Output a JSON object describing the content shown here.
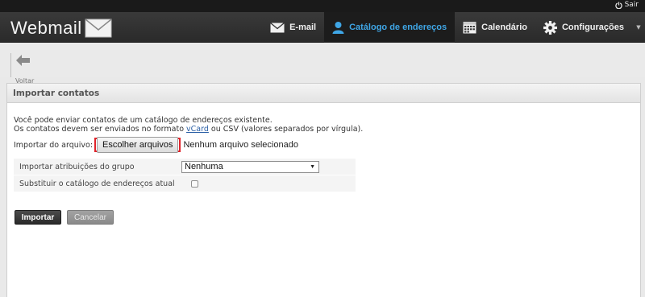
{
  "topbar": {
    "logout_label": "Sair"
  },
  "header": {
    "brand": "Webmail"
  },
  "nav": {
    "items": [
      {
        "label": "E-mail",
        "icon": "envelope-icon"
      },
      {
        "label": "Catálogo de endereços",
        "icon": "person-icon",
        "active": true
      },
      {
        "label": "Calendário",
        "icon": "calendar-icon"
      },
      {
        "label": "Configurações",
        "icon": "gear-icon"
      }
    ]
  },
  "toolbar": {
    "back_label": "Voltar"
  },
  "panel": {
    "title": "Importar contatos",
    "intro_line1": "Você pode enviar contatos de um catálogo de endereços existente.",
    "intro_line2_pre": "Os contatos devem ser enviados no formato ",
    "intro_link": "vCard",
    "intro_line2_post": " ou CSV (valores separados por vírgula).",
    "file_label": "Importar do arquivo:",
    "file_button": "Escolher arquivos",
    "file_status": "Nenhum arquivo selecionado",
    "options": [
      {
        "label": "Importar atribuições do grupo",
        "value": "Nenhuma"
      },
      {
        "label": "Substituir o catálogo de endereços atual",
        "checked": false
      }
    ],
    "import_button": "Importar",
    "cancel_button": "Cancelar"
  },
  "colors": {
    "accent": "#3fa6e6",
    "highlight_border": "#e0242b"
  }
}
